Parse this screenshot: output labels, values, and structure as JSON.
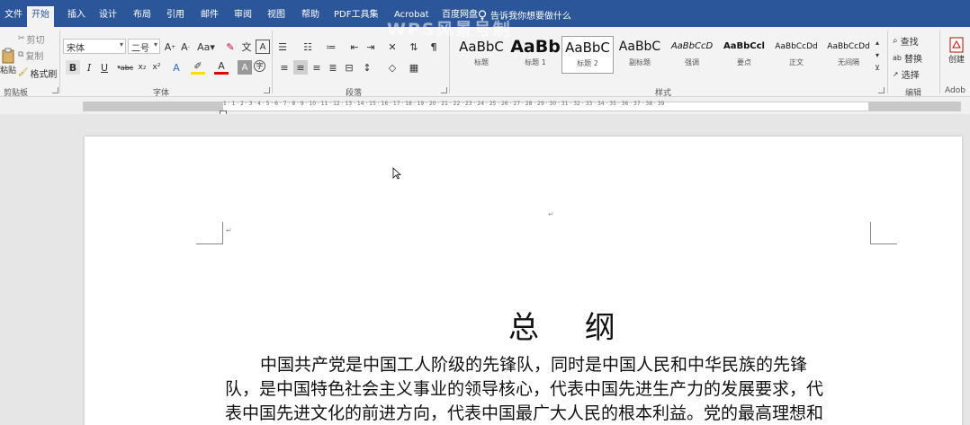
{
  "tabs": [
    "文件",
    "开始",
    "插入",
    "设计",
    "布局",
    "引用",
    "邮件",
    "审阅",
    "视图",
    "帮助",
    "PDF工具集",
    "Acrobat",
    "百度网盘"
  ],
  "tell_me": "告诉我你想要做什么",
  "watermark": "WPS风景号制",
  "clipboard": {
    "cut": "剪切",
    "copy": "复制",
    "format_painter": "格式刷",
    "paste": "粘贴",
    "label": "剪贴板"
  },
  "font": {
    "name": "宋体",
    "size": "二号",
    "label": "字体"
  },
  "paragraph": {
    "label": "段落"
  },
  "styles": {
    "label": "样式",
    "items": [
      {
        "sample": "AaBbC",
        "name": "标题"
      },
      {
        "sample": "AaBb",
        "name": "标题 1"
      },
      {
        "sample": "AaBbC",
        "name": "标题 2"
      },
      {
        "sample": "AaBbC",
        "name": "副标题"
      },
      {
        "sample": "AaBbCcD",
        "name": "强调"
      },
      {
        "sample": "AaBbCcl",
        "name": "要点"
      },
      {
        "sample": "AaBbCcDd",
        "name": "正文"
      },
      {
        "sample": "AaBbCcDd",
        "name": "无间隔"
      }
    ]
  },
  "editing": {
    "find": "查找",
    "replace": "替换",
    "select": "选择",
    "label": "编辑"
  },
  "adobe": {
    "create": "创建",
    "label": "Adob"
  },
  "ruler_numbers": "1 · 1 · 2 · 3 · 4 · 5 · 6 · 7 · 8 · 9 · 10 · 11 · 12 · 13 · 14 · 15 · 16 · 17 · 18 · 19 · 20 · 21 · 22 · 23 · 24 · 25 · 26 · 27 · 28 · 29 · 30 · 31 · 32 · 33 · 34 · 35 · 36 · 37 · 38 · 39",
  "document": {
    "title": "总 纲",
    "lines": [
      "中国共产党是中国工人阶级的先锋队，同时是中国人民和中华民族的先锋",
      "队，是中国特色社会主义事业的领导核心，代表中国先进生产力的发展要求，代",
      "表中国先进文化的前进方向，代表中国最广大人民的根本利益。党的最高理想和"
    ]
  }
}
